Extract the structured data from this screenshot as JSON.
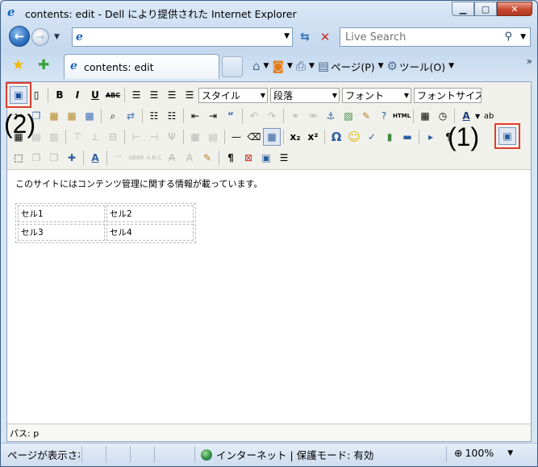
{
  "window": {
    "title": "contents: edit - Dell により提供された Internet Explorer",
    "controls": {
      "minimize": "▭",
      "maximize": "▢",
      "close": "✕"
    }
  },
  "addressbar": {
    "url": "",
    "search_placeholder": "Live Search"
  },
  "tab": {
    "label": "contents: edit"
  },
  "commandbar": {
    "page": "ページ(P)",
    "tools": "ツール(O)"
  },
  "editor": {
    "selects": {
      "style": "スタイル",
      "paragraph": "段落",
      "font": "フォント",
      "fontsize": "フォントサイズ"
    },
    "annotations": {
      "a1": "(1)",
      "a2": "(2)"
    },
    "content_text": "このサイトにはコンテンツ管理に関する情報が載っています。",
    "table": [
      [
        "セル1",
        "セル2"
      ],
      [
        "セル3",
        "セル4"
      ]
    ],
    "path": "パス: p"
  },
  "status": {
    "text": "ページが表示されました",
    "zone": "インターネット | 保護モード: 有効",
    "zoom": "100%"
  },
  "icons": [
    "ie-logo-icon",
    "back-arrow-icon",
    "forward-arrow-icon",
    "refresh-icon",
    "stop-icon",
    "search-icon",
    "favorites-star-icon",
    "add-favorites-icon",
    "home-icon",
    "feed-icon",
    "print-icon",
    "page-icon",
    "tools-gear-icon",
    "save-icon",
    "new-doc-icon",
    "source-view-icon",
    "globe-icon",
    "zoom-icon"
  ],
  "colors": {
    "highlight_box": "#e03c2b",
    "title_bar": "#c4d8ef",
    "close_button": "#c7462d"
  }
}
